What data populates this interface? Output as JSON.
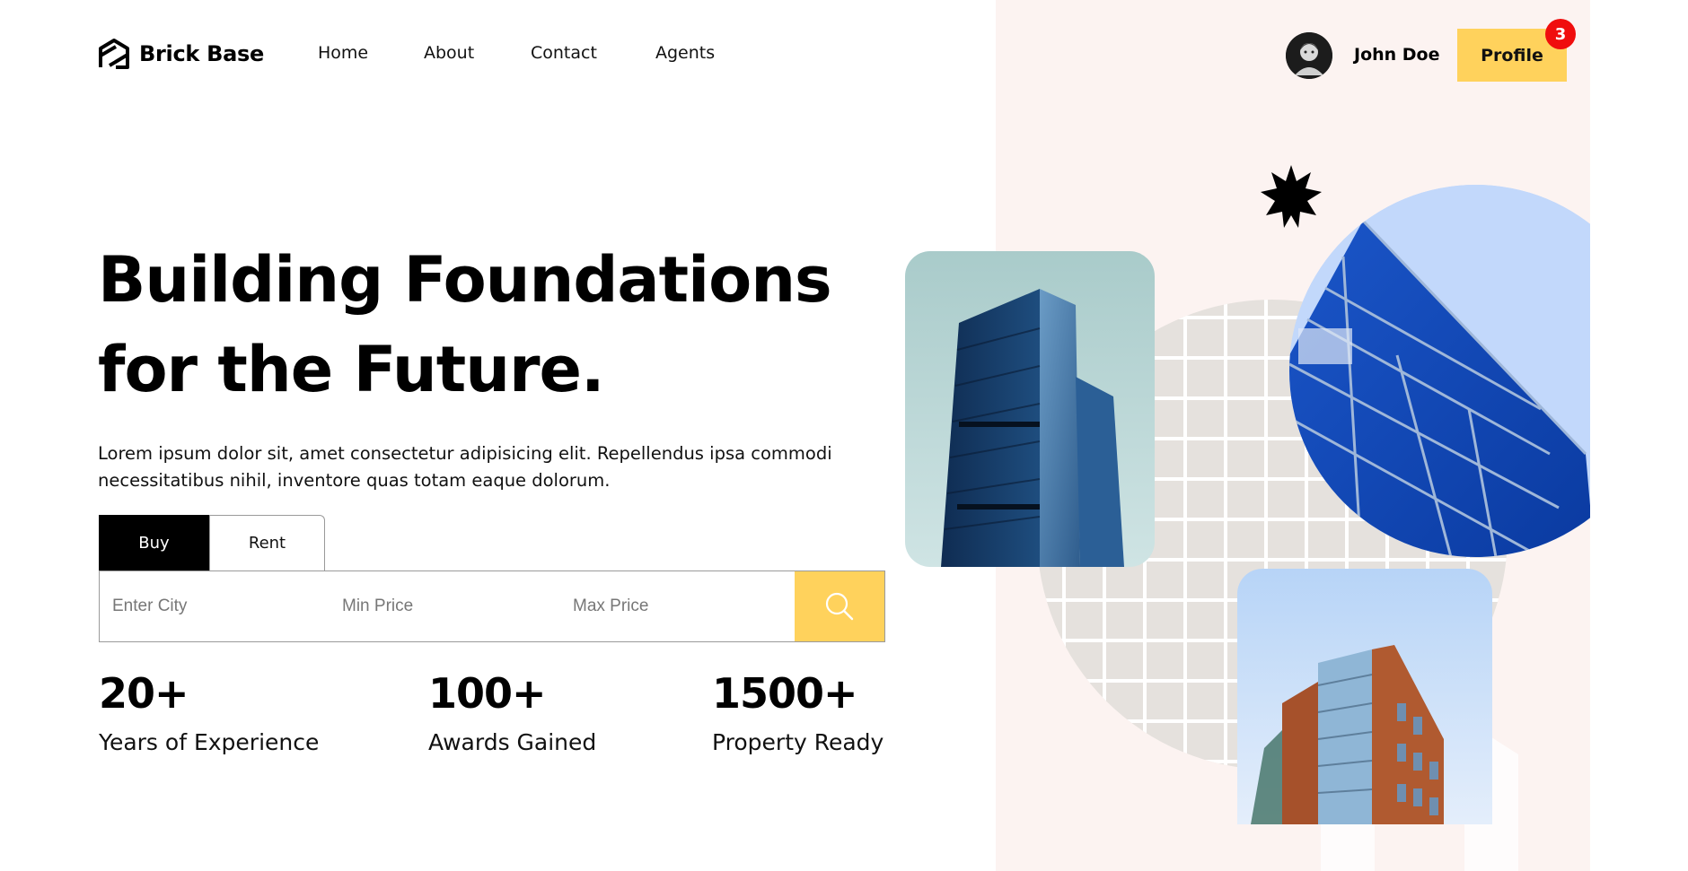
{
  "brand": {
    "name": "Brick Base"
  },
  "nav": {
    "home": "Home",
    "about": "About",
    "contact": "Contact",
    "agents": "Agents"
  },
  "user": {
    "name": "John Doe",
    "profile_label": "Profile",
    "notifications": "3"
  },
  "hero": {
    "title": "Building Foundations for the Future.",
    "description": "Lorem ipsum dolor sit, amet consectetur adipisicing elit. Repellendus ipsa commodi necessitatibus nihil, inventore quas totam eaque dolorum."
  },
  "search": {
    "tabs": {
      "buy": "Buy",
      "rent": "Rent"
    },
    "active_tab": "Buy",
    "city_placeholder": "Enter City",
    "min_price_placeholder": "Min Price",
    "max_price_placeholder": "Max Price",
    "button_icon": "search-icon"
  },
  "stats": [
    {
      "value": "20+",
      "label": "Years of Experience"
    },
    {
      "value": "100+",
      "label": "Awards Gained"
    },
    {
      "value": "1500+",
      "label": "Property Ready"
    }
  ],
  "colors": {
    "accent": "#ffd25c",
    "badge": "#f00d0d",
    "panel": "#fcf3f1",
    "active_tab": "#000000"
  }
}
